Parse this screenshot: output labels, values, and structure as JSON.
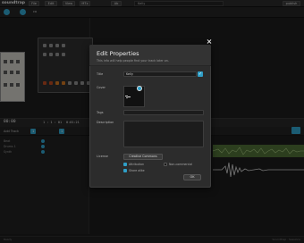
{
  "app": {
    "logo_text": "soundtrap",
    "menu": [
      "File",
      "Edit",
      "View",
      "MTx",
      "Ab"
    ],
    "project_title": "Kelly",
    "publish_label": "publish"
  },
  "subbar": {
    "kit_label": "co"
  },
  "transport": {
    "time": "00:00",
    "position": "1 : 1 : 01",
    "extra": "0:01:21"
  },
  "tracks": {
    "add_track_label": "Add Track",
    "bpm_chip": "1",
    "names": [
      "Beat",
      "Drums 1",
      "Synth"
    ]
  },
  "status": {
    "left": "Ready",
    "right": "Soundtrap · Sessions"
  },
  "modal": {
    "title": "Edit Properties",
    "subtitle": "This info will help people find your track later on.",
    "fields": {
      "title_label": "Title",
      "title_value": "Kelly",
      "cover_label": "Cover",
      "tags_label": "Tags",
      "tags_value": "",
      "description_label": "Description",
      "license_label": "License",
      "license_button": "Creative Commons"
    },
    "options": [
      {
        "label": "Attribution",
        "checked": true
      },
      {
        "label": "Non-commercial",
        "checked": false
      },
      {
        "label": "Share alike",
        "checked": true
      }
    ],
    "ok_label": "OK",
    "close_symbol": "×"
  },
  "colors": {
    "accent": "#2f9fc7",
    "clip": "#4d6b34",
    "modal_bg": "#2c2c2c"
  }
}
